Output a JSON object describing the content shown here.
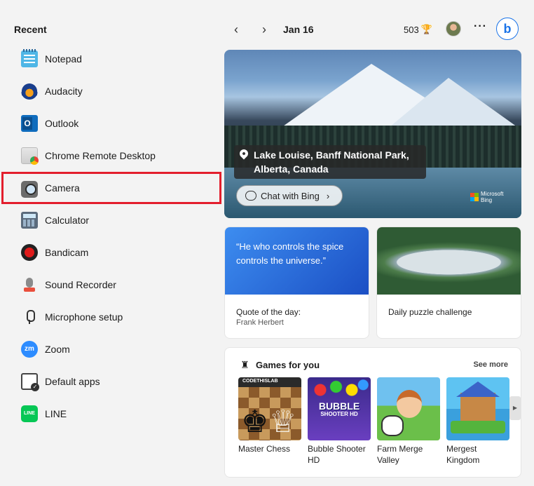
{
  "recent": {
    "title": "Recent",
    "items": [
      {
        "label": "Notepad",
        "icon": "notepad-icon"
      },
      {
        "label": "Audacity",
        "icon": "audacity-icon"
      },
      {
        "label": "Outlook",
        "icon": "outlook-icon"
      },
      {
        "label": "Chrome Remote Desktop",
        "icon": "chrome-remote-desktop-icon"
      },
      {
        "label": "Camera",
        "icon": "camera-icon"
      },
      {
        "label": "Calculator",
        "icon": "calculator-icon"
      },
      {
        "label": "Bandicam",
        "icon": "bandicam-icon"
      },
      {
        "label": "Sound Recorder",
        "icon": "sound-recorder-icon"
      },
      {
        "label": "Microphone setup",
        "icon": "microphone-icon"
      },
      {
        "label": "Zoom",
        "icon": "zoom-icon",
        "icon_text": "zm"
      },
      {
        "label": "Default apps",
        "icon": "default-apps-icon"
      },
      {
        "label": "LINE",
        "icon": "line-icon",
        "icon_text": "LINE"
      }
    ]
  },
  "topbar": {
    "date": "Jan 16",
    "points": "503",
    "more": "···"
  },
  "hero": {
    "location_line1": "Lake Louise, Banff National Park,",
    "location_line2": "Alberta, Canada",
    "chat_label": "Chat with Bing",
    "brand_line1": "Microsoft",
    "brand_line2": "Bing"
  },
  "quote": {
    "text": "“He who controls the spice controls the universe.”",
    "label": "Quote of the day:",
    "author": "Frank Herbert"
  },
  "puzzle": {
    "label": "Daily puzzle challenge"
  },
  "games": {
    "title": "Games for you",
    "see_more": "See more",
    "items": [
      {
        "name": "Master Chess",
        "thumb_label": "CODETHISLAB"
      },
      {
        "name": "Bubble Shooter HD",
        "thumb_label": "BUBBLE",
        "thumb_label2": "SHOOTER HD"
      },
      {
        "name": "Farm Merge Valley"
      },
      {
        "name": "Mergest Kingdom"
      }
    ]
  },
  "colors": {
    "highlight": "#e31e2d",
    "accent": "#1a73e8"
  }
}
